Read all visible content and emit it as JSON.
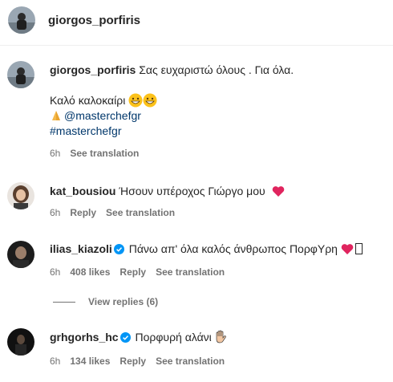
{
  "header": {
    "username": "giorgos_porfiris"
  },
  "comments": [
    {
      "username": "giorgos_porfiris",
      "text": "Σας ευχαριστώ όλους . Για όλα.",
      "line2": "Καλό καλοκαίρι",
      "mention": "@masterchefgr",
      "hashtag": "#masterchefgr",
      "time": "6h",
      "see_translation": "See translation"
    },
    {
      "username": "kat_bousiou",
      "text": "Ήσουν υπέροχος Γιώργο μου",
      "time": "6h",
      "reply": "Reply",
      "see_translation": "See translation"
    },
    {
      "username": "ilias_kiazoli",
      "verified": true,
      "text": "Πάνω απ' όλα καλός άνθρωπος ΠορφΥρη",
      "time": "6h",
      "likes": "408 likes",
      "reply": "Reply",
      "see_translation": "See translation",
      "view_replies": "View replies (6)"
    },
    {
      "username": "grhgorhs_hc",
      "verified": true,
      "text": "Πορφυρή αλάνι",
      "time": "6h",
      "likes": "134 likes",
      "reply": "Reply",
      "see_translation": "See translation"
    }
  ],
  "colors": {
    "verified_blue": "#0095f6",
    "heart_red": "#e0245e",
    "muted_text": "#737373",
    "link_text": "#00376b"
  },
  "icons": [
    "verified-badge-icon",
    "heart-icon",
    "grinning-face-icon",
    "folded-hands-icon",
    "waving-hand-icon"
  ]
}
